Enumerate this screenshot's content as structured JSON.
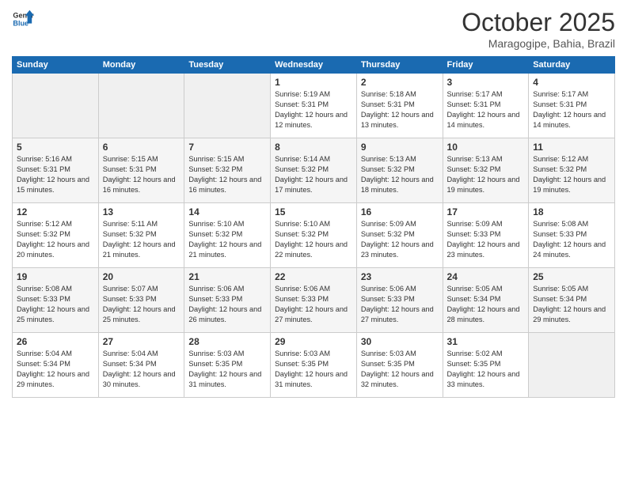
{
  "header": {
    "logo_general": "General",
    "logo_blue": "Blue",
    "month": "October 2025",
    "location": "Maragogipe, Bahia, Brazil"
  },
  "days_of_week": [
    "Sunday",
    "Monday",
    "Tuesday",
    "Wednesday",
    "Thursday",
    "Friday",
    "Saturday"
  ],
  "weeks": [
    [
      {
        "num": "",
        "info": ""
      },
      {
        "num": "",
        "info": ""
      },
      {
        "num": "",
        "info": ""
      },
      {
        "num": "1",
        "info": "Sunrise: 5:19 AM\nSunset: 5:31 PM\nDaylight: 12 hours and 12 minutes."
      },
      {
        "num": "2",
        "info": "Sunrise: 5:18 AM\nSunset: 5:31 PM\nDaylight: 12 hours and 13 minutes."
      },
      {
        "num": "3",
        "info": "Sunrise: 5:17 AM\nSunset: 5:31 PM\nDaylight: 12 hours and 14 minutes."
      },
      {
        "num": "4",
        "info": "Sunrise: 5:17 AM\nSunset: 5:31 PM\nDaylight: 12 hours and 14 minutes."
      }
    ],
    [
      {
        "num": "5",
        "info": "Sunrise: 5:16 AM\nSunset: 5:31 PM\nDaylight: 12 hours and 15 minutes."
      },
      {
        "num": "6",
        "info": "Sunrise: 5:15 AM\nSunset: 5:31 PM\nDaylight: 12 hours and 16 minutes."
      },
      {
        "num": "7",
        "info": "Sunrise: 5:15 AM\nSunset: 5:32 PM\nDaylight: 12 hours and 16 minutes."
      },
      {
        "num": "8",
        "info": "Sunrise: 5:14 AM\nSunset: 5:32 PM\nDaylight: 12 hours and 17 minutes."
      },
      {
        "num": "9",
        "info": "Sunrise: 5:13 AM\nSunset: 5:32 PM\nDaylight: 12 hours and 18 minutes."
      },
      {
        "num": "10",
        "info": "Sunrise: 5:13 AM\nSunset: 5:32 PM\nDaylight: 12 hours and 19 minutes."
      },
      {
        "num": "11",
        "info": "Sunrise: 5:12 AM\nSunset: 5:32 PM\nDaylight: 12 hours and 19 minutes."
      }
    ],
    [
      {
        "num": "12",
        "info": "Sunrise: 5:12 AM\nSunset: 5:32 PM\nDaylight: 12 hours and 20 minutes."
      },
      {
        "num": "13",
        "info": "Sunrise: 5:11 AM\nSunset: 5:32 PM\nDaylight: 12 hours and 21 minutes."
      },
      {
        "num": "14",
        "info": "Sunrise: 5:10 AM\nSunset: 5:32 PM\nDaylight: 12 hours and 21 minutes."
      },
      {
        "num": "15",
        "info": "Sunrise: 5:10 AM\nSunset: 5:32 PM\nDaylight: 12 hours and 22 minutes."
      },
      {
        "num": "16",
        "info": "Sunrise: 5:09 AM\nSunset: 5:32 PM\nDaylight: 12 hours and 23 minutes."
      },
      {
        "num": "17",
        "info": "Sunrise: 5:09 AM\nSunset: 5:33 PM\nDaylight: 12 hours and 23 minutes."
      },
      {
        "num": "18",
        "info": "Sunrise: 5:08 AM\nSunset: 5:33 PM\nDaylight: 12 hours and 24 minutes."
      }
    ],
    [
      {
        "num": "19",
        "info": "Sunrise: 5:08 AM\nSunset: 5:33 PM\nDaylight: 12 hours and 25 minutes."
      },
      {
        "num": "20",
        "info": "Sunrise: 5:07 AM\nSunset: 5:33 PM\nDaylight: 12 hours and 25 minutes."
      },
      {
        "num": "21",
        "info": "Sunrise: 5:06 AM\nSunset: 5:33 PM\nDaylight: 12 hours and 26 minutes."
      },
      {
        "num": "22",
        "info": "Sunrise: 5:06 AM\nSunset: 5:33 PM\nDaylight: 12 hours and 27 minutes."
      },
      {
        "num": "23",
        "info": "Sunrise: 5:06 AM\nSunset: 5:33 PM\nDaylight: 12 hours and 27 minutes."
      },
      {
        "num": "24",
        "info": "Sunrise: 5:05 AM\nSunset: 5:34 PM\nDaylight: 12 hours and 28 minutes."
      },
      {
        "num": "25",
        "info": "Sunrise: 5:05 AM\nSunset: 5:34 PM\nDaylight: 12 hours and 29 minutes."
      }
    ],
    [
      {
        "num": "26",
        "info": "Sunrise: 5:04 AM\nSunset: 5:34 PM\nDaylight: 12 hours and 29 minutes."
      },
      {
        "num": "27",
        "info": "Sunrise: 5:04 AM\nSunset: 5:34 PM\nDaylight: 12 hours and 30 minutes."
      },
      {
        "num": "28",
        "info": "Sunrise: 5:03 AM\nSunset: 5:35 PM\nDaylight: 12 hours and 31 minutes."
      },
      {
        "num": "29",
        "info": "Sunrise: 5:03 AM\nSunset: 5:35 PM\nDaylight: 12 hours and 31 minutes."
      },
      {
        "num": "30",
        "info": "Sunrise: 5:03 AM\nSunset: 5:35 PM\nDaylight: 12 hours and 32 minutes."
      },
      {
        "num": "31",
        "info": "Sunrise: 5:02 AM\nSunset: 5:35 PM\nDaylight: 12 hours and 33 minutes."
      },
      {
        "num": "",
        "info": ""
      }
    ]
  ]
}
